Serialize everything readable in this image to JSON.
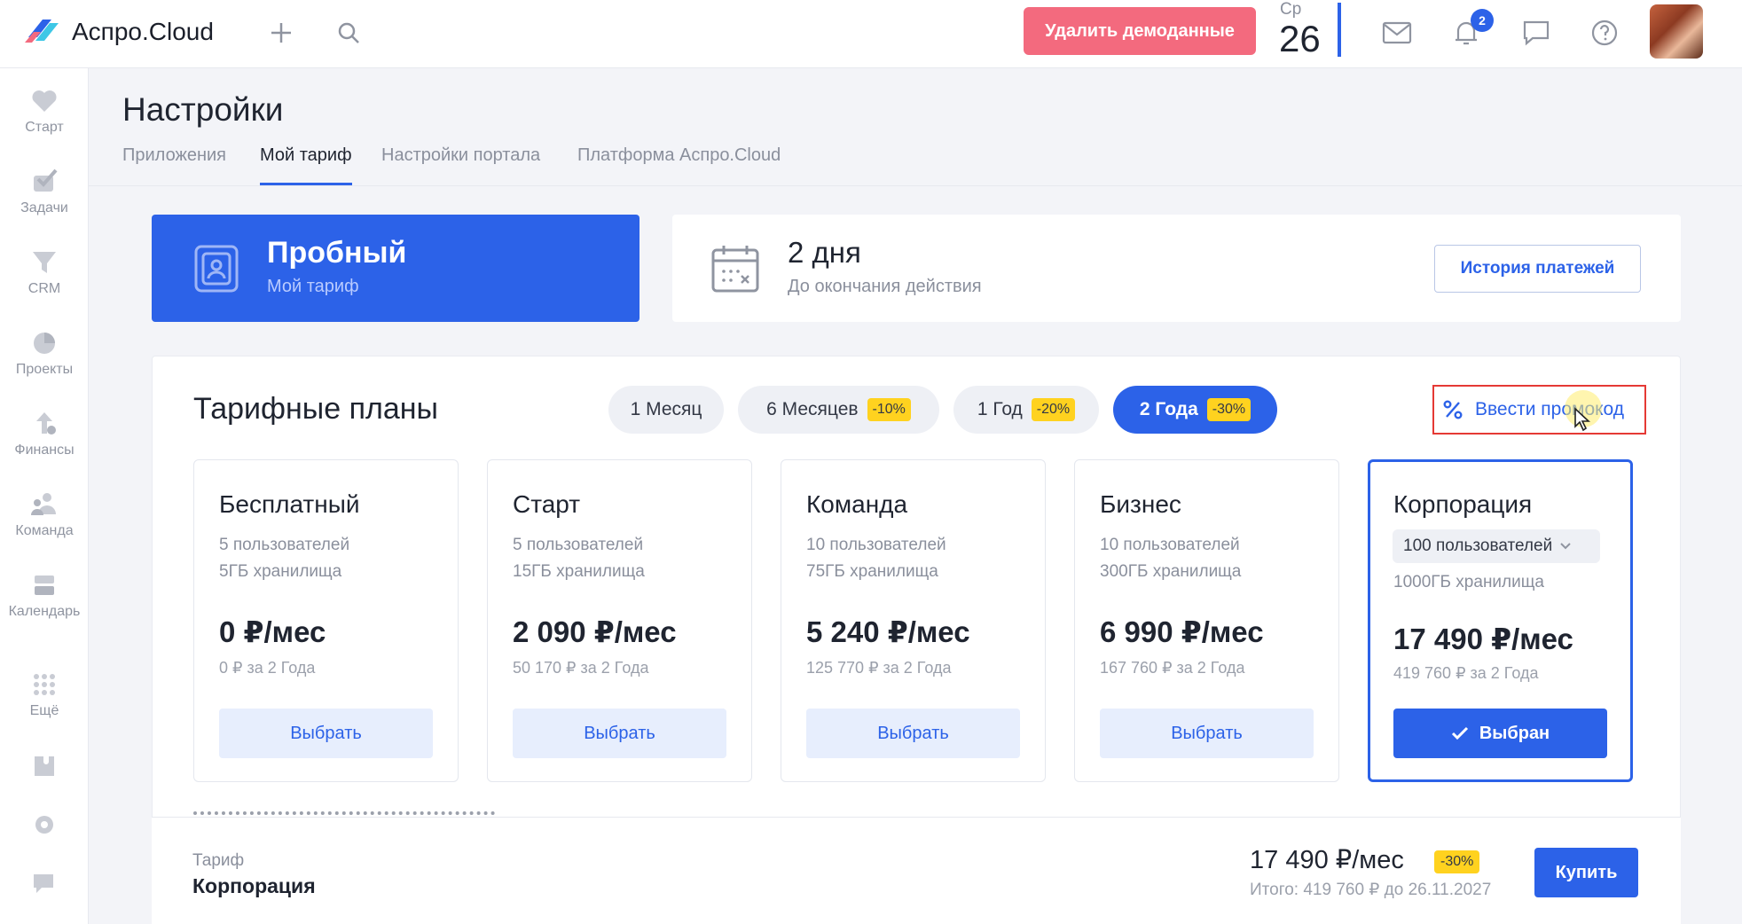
{
  "topbar": {
    "brand": "Аспро.Cloud",
    "delete_demo_label": "Удалить демоданные",
    "date_day": "Ср",
    "date_num": "26",
    "notifications_count": "2",
    "accent": "#2c62e8",
    "danger": "#f36a7e"
  },
  "sidebar": {
    "items": [
      {
        "label": "Старт",
        "icon": "heart-icon"
      },
      {
        "label": "Задачи",
        "icon": "check-icon"
      },
      {
        "label": "CRM",
        "icon": "funnel-icon"
      },
      {
        "label": "Проекты",
        "icon": "pie-icon"
      },
      {
        "label": "Финансы",
        "icon": "coins-icon"
      },
      {
        "label": "Команда",
        "icon": "team-icon"
      },
      {
        "label": "Календарь",
        "icon": "calendar-icon"
      },
      {
        "label": "Ещё",
        "icon": "grid-icon"
      }
    ]
  },
  "page": {
    "title": "Настройки",
    "tabs": [
      "Приложения",
      "Мой тариф",
      "Настройки портала",
      "Платформа Аспро.Cloud"
    ],
    "active_tab": "Мой тариф"
  },
  "current_plan": {
    "name": "Пробный",
    "sub": "Мой тариф",
    "days": "2 дня",
    "days_sub": "До окончания действия",
    "history_label": "История платежей"
  },
  "plans": {
    "title": "Тарифные планы",
    "periods": [
      {
        "label": "1 Месяц",
        "discount": ""
      },
      {
        "label": "6 Месяцев",
        "discount": "-10%"
      },
      {
        "label": "1 Год",
        "discount": "-20%"
      },
      {
        "label": "2 Года",
        "discount": "-30%"
      }
    ],
    "active_period": "2 Года",
    "promo_label": "Ввести промокод",
    "tiers": [
      {
        "name": "Бесплатный",
        "users": "5 пользователей",
        "storage": "5ГБ хранилища",
        "price": "0 ₽/мес",
        "total": "0 ₽ за 2 Года",
        "button": "Выбрать"
      },
      {
        "name": "Старт",
        "users": "5 пользователей",
        "storage": "15ГБ хранилища",
        "price": "2 090 ₽/мес",
        "total": "50 170 ₽ за 2 Года",
        "button": "Выбрать"
      },
      {
        "name": "Команда",
        "users": "10 пользователей",
        "storage": "75ГБ хранилища",
        "price": "5 240 ₽/мес",
        "total": "125 770 ₽ за 2 Года",
        "button": "Выбрать"
      },
      {
        "name": "Бизнес",
        "users": "10 пользователей",
        "storage": "300ГБ хранилища",
        "price": "6 990 ₽/мес",
        "total": "167 760 ₽ за 2 Года",
        "button": "Выбрать"
      },
      {
        "name": "Корпорация",
        "users": "100 пользователей",
        "storage": "1000ГБ хранилища",
        "price": "17 490 ₽/мес",
        "total": "419 760 ₽ за 2 Года",
        "button": "Выбран"
      }
    ],
    "selected_tier": "Корпорация"
  },
  "footer": {
    "label": "Тариф",
    "name": "Корпорация",
    "price": "17 490 ₽/мес",
    "discount": "-30%",
    "total": "Итого: 419 760 ₽ до 26.11.2027",
    "buy_label": "Купить"
  }
}
